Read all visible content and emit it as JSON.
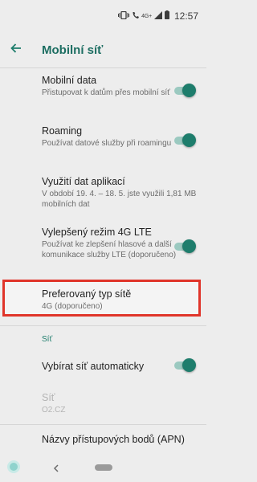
{
  "status_bar": {
    "network": "4G+",
    "time": "12:57"
  },
  "app_bar": {
    "title": "Mobilní síť",
    "back_icon": "arrow-left-icon"
  },
  "settings": [
    {
      "title": "Mobilní data",
      "summary": "Přistupovat k datům přes mobilní síť",
      "toggle": true
    },
    {
      "title": "Roaming",
      "summary": "Používat datové služby při roamingu",
      "toggle": true
    },
    {
      "title": "Využití dat aplikací",
      "summary": "V období 19. 4. – 18. 5. jste využili 1,81 MB mobilních dat"
    },
    {
      "title": "Vylepšený režim 4G LTE",
      "summary": "Používat ke zlepšení hlasové a další komunikace služby LTE (doporučeno)",
      "toggle": true
    },
    {
      "title": "Preferovaný typ sítě",
      "summary": "4G (doporučeno)"
    }
  ],
  "network_section": {
    "header": "Síť",
    "auto_select": {
      "title": "Vybírat síť automaticky",
      "toggle": true
    },
    "network": {
      "title": "Síť",
      "summary": "O2.CZ"
    },
    "apn": {
      "title": "Názvy přístupových bodů (APN)"
    }
  },
  "colors": {
    "accent": "#1e7d6c",
    "toggle_track": "#9bc9c0",
    "highlight": "#e0352a",
    "background": "#ededed"
  }
}
